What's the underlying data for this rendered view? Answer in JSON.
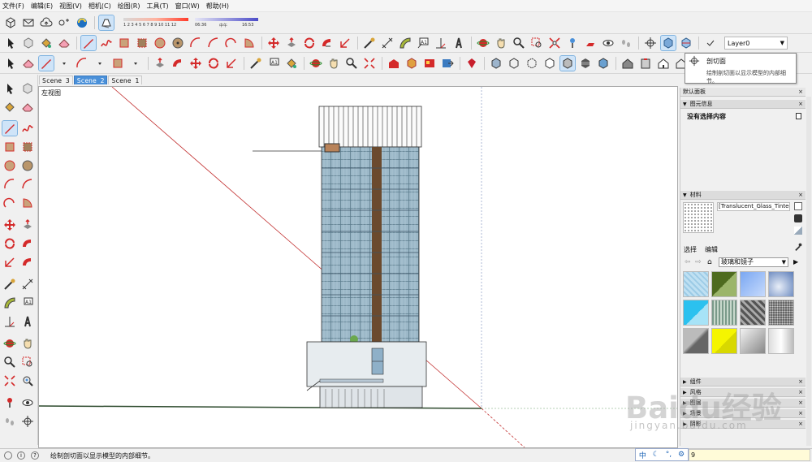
{
  "menubar": {
    "items": [
      "文件(F)",
      "编辑(E)",
      "视图(V)",
      "相机(C)",
      "绘图(R)",
      "工具(T)",
      "窗口(W)",
      "帮助(H)"
    ]
  },
  "shadow_settings": {
    "months": "1 2 3 4 5 6 7 8 9 10 11 12",
    "time_start": "06:36",
    "time_mid": "中午",
    "time_end": "16:53"
  },
  "layer": {
    "selected": "Layer0"
  },
  "scenes": {
    "tabs": [
      "Scene 3",
      "Scene 2",
      "Scene 1"
    ],
    "active": "Scene 2"
  },
  "viewport": {
    "view_label": "左视图"
  },
  "tooltip": {
    "title": "剖切面",
    "description": "绘制剖切面以显示模型的内部细节。"
  },
  "tray": {
    "title": "默认面板",
    "entity_info": {
      "header": "图元信息",
      "status": "没有选择内容"
    },
    "materials": {
      "header": "材料",
      "material_name": "[Translucent_Glass_Tinted]",
      "tab_select": "选择",
      "tab_edit": "编辑",
      "collection": "玻璃和镜子"
    },
    "collapsed_panels": [
      "组件",
      "风格",
      "图层",
      "场景",
      "阴影"
    ]
  },
  "statusbar": {
    "text": "绘制剖切面以显示模型的内部细节。",
    "measurement": "9"
  },
  "ime": {
    "lang": "中"
  },
  "watermark": {
    "text": "Baidu经验",
    "url": "jingyan.baidu.com"
  },
  "colors": {
    "accent": "#4a90d9",
    "red_tool": "#d42a2a",
    "glass": "#8fb2c8"
  }
}
